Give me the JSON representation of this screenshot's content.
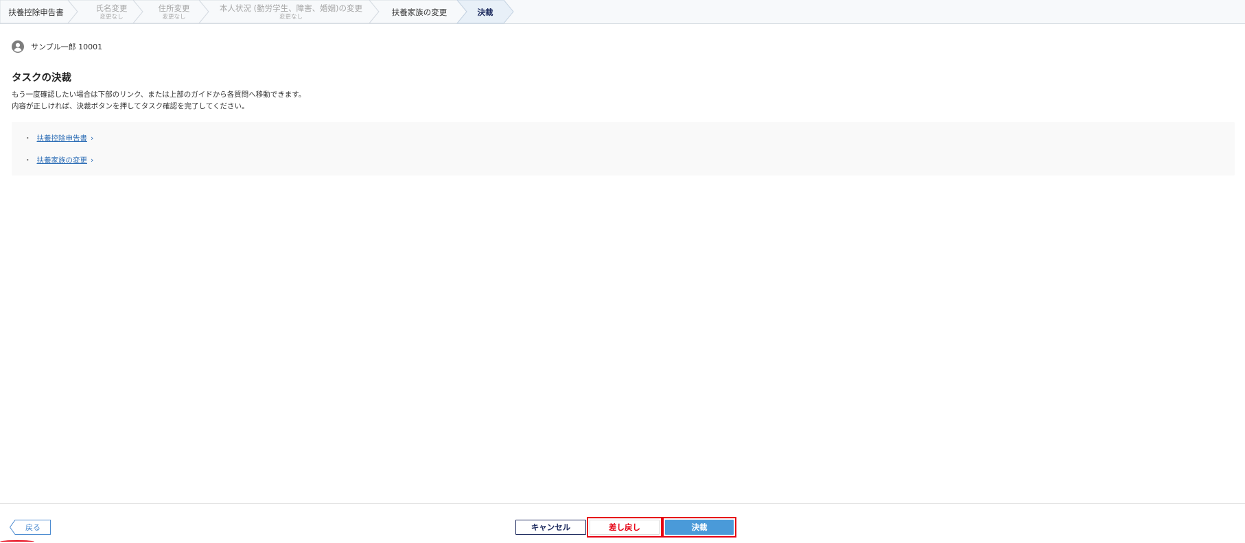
{
  "steps": [
    {
      "title": "扶養控除申告書",
      "sub": "",
      "state": "done"
    },
    {
      "title": "氏名変更",
      "sub": "変更なし",
      "state": "skip"
    },
    {
      "title": "住所変更",
      "sub": "変更なし",
      "state": "skip"
    },
    {
      "title": "本人状況 (勤労学生、障害、婚姻)の変更",
      "sub": "変更なし",
      "state": "skip"
    },
    {
      "title": "扶養家族の変更",
      "sub": "",
      "state": "done"
    },
    {
      "title": "決裁",
      "sub": "",
      "state": "current"
    }
  ],
  "user": {
    "icon": "user-avatar-icon",
    "name": "サンプル一郎 10001"
  },
  "page": {
    "title": "タスクの決裁",
    "description": [
      "もう一度確認したい場合は下部のリンク、または上部のガイドから各質問へ移動できます。",
      "内容が正しければ、決裁ボタンを押してタスク確認を完了してください。"
    ]
  },
  "links": [
    {
      "label": "扶養控除申告書"
    },
    {
      "label": "扶養家族の変更"
    }
  ],
  "footer": {
    "back_label": "戻る",
    "cancel_label": "キャンセル",
    "return_label": "差し戻し",
    "approve_label": "決裁"
  },
  "colors": {
    "accent_navy": "#1c2a5e",
    "approve_blue": "#4a9ad9",
    "link_blue": "#2f6fb7",
    "highlight_red": "#e60012",
    "current_step_bg": "#e8f0f8"
  }
}
